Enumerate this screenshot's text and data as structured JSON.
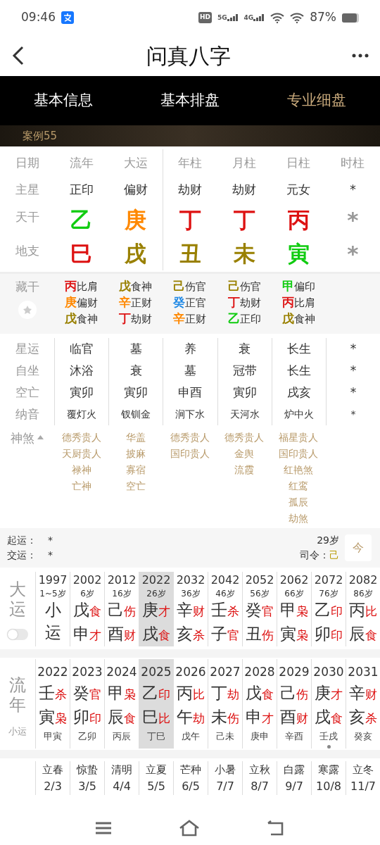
{
  "status_bar": {
    "time": "09:46",
    "hd": "HD",
    "networks": [
      "5G",
      "4G"
    ],
    "battery": "87%"
  },
  "header": {
    "title": "问真八字"
  },
  "tabs": [
    {
      "label": "基本信息",
      "selected": false
    },
    {
      "label": "基本排盘",
      "selected": false
    },
    {
      "label": "专业细盘",
      "selected": true
    }
  ],
  "case_label": "案例55",
  "pillars": {
    "row_labels": [
      "日期",
      "主星",
      "天干",
      "地支"
    ],
    "columns": [
      {
        "heading": "流年",
        "main_star": "正印",
        "stem": {
          "char": "乙",
          "color": "#11cc11"
        },
        "branch": {
          "char": "巳",
          "color": "#dd1111"
        }
      },
      {
        "heading": "大运",
        "main_star": "偏财",
        "stem": {
          "char": "庚",
          "color": "#ff8800"
        },
        "branch": {
          "char": "戌",
          "color": "#998000"
        }
      },
      {
        "heading": "年柱",
        "main_star": "劫财",
        "stem": {
          "char": "丁",
          "color": "#dd1111"
        },
        "branch": {
          "char": "丑",
          "color": "#998000"
        }
      },
      {
        "heading": "月柱",
        "main_star": "劫财",
        "stem": {
          "char": "丁",
          "color": "#dd1111"
        },
        "branch": {
          "char": "未",
          "color": "#998000"
        }
      },
      {
        "heading": "日柱",
        "main_star": "元女",
        "stem": {
          "char": "丙",
          "color": "#dd1111"
        },
        "branch": {
          "char": "寅",
          "color": "#11cc11"
        }
      },
      {
        "heading": "时柱",
        "main_star": "*",
        "stem": {
          "char": "*",
          "color": "#999999"
        },
        "branch": {
          "char": "*",
          "color": "#999999"
        }
      }
    ]
  },
  "hidden_stems": {
    "label": "藏干",
    "columns": [
      [
        {
          "char": "丙",
          "color": "#dd1111",
          "god": "比肩"
        },
        {
          "char": "庚",
          "color": "#ff8800",
          "god": "偏财"
        },
        {
          "char": "戊",
          "color": "#998000",
          "god": "食神"
        }
      ],
      [
        {
          "char": "戊",
          "color": "#998000",
          "god": "食神"
        },
        {
          "char": "辛",
          "color": "#ff8800",
          "god": "正财"
        },
        {
          "char": "丁",
          "color": "#dd1111",
          "god": "劫财"
        }
      ],
      [
        {
          "char": "己",
          "color": "#998000",
          "god": "伤官"
        },
        {
          "char": "癸",
          "color": "#1e88e5",
          "god": "正官"
        },
        {
          "char": "辛",
          "color": "#ff8800",
          "god": "正财"
        }
      ],
      [
        {
          "char": "己",
          "color": "#998000",
          "god": "伤官"
        },
        {
          "char": "丁",
          "color": "#dd1111",
          "god": "劫财"
        },
        {
          "char": "乙",
          "color": "#11cc11",
          "god": "正印"
        }
      ],
      [
        {
          "char": "甲",
          "color": "#11cc11",
          "god": "偏印"
        },
        {
          "char": "丙",
          "color": "#dd1111",
          "god": "比肩"
        },
        {
          "char": "戊",
          "color": "#998000",
          "god": "食神"
        }
      ]
    ]
  },
  "details": [
    {
      "label": "星运",
      "values": [
        "临官",
        "墓",
        "养",
        "衰",
        "长生",
        "*"
      ]
    },
    {
      "label": "自坐",
      "values": [
        "沐浴",
        "衰",
        "墓",
        "冠带",
        "长生",
        "*"
      ]
    },
    {
      "label": "空亡",
      "values": [
        "寅卯",
        "寅卯",
        "申酉",
        "寅卯",
        "戌亥",
        "*"
      ]
    },
    {
      "label": "纳音",
      "values": [
        "覆灯火",
        "钗钏金",
        "涧下水",
        "天河水",
        "炉中火",
        "*"
      ]
    }
  ],
  "shensha": {
    "label": "神煞",
    "expanded": true,
    "columns": [
      [
        "德秀贵人",
        "天厨贵人",
        "禄神",
        "亡神"
      ],
      [
        "华盖",
        "披麻",
        "寡宿",
        "空亡"
      ],
      [
        "德秀贵人",
        "国印贵人"
      ],
      [
        "德秀贵人",
        "金舆",
        "流霞"
      ],
      [
        "福星贵人",
        "国印贵人",
        "红艳煞",
        "红鸾",
        "孤辰",
        "劫煞"
      ]
    ]
  },
  "info": {
    "qiyun_label": "起运：",
    "qiyun_value": "*",
    "jiaoyun_label": "交运：",
    "jiaoyun_value": "*",
    "age": "29岁",
    "siling_label": "司令：",
    "siling_value": "己",
    "calendar_label": "今"
  },
  "dayun": {
    "label": "大运",
    "toggle_on": false,
    "columns": [
      {
        "year": "1997",
        "age": "1~5岁",
        "stem": "小",
        "branch": "运",
        "selected": false
      },
      {
        "year": "2002",
        "age": "6岁",
        "stem": "戊",
        "stem_god": "食",
        "branch": "申",
        "branch_god": "才",
        "selected": false
      },
      {
        "year": "2012",
        "age": "16岁",
        "stem": "己",
        "stem_god": "伤",
        "branch": "酉",
        "branch_god": "财",
        "selected": false
      },
      {
        "year": "2022",
        "age": "26岁",
        "stem": "庚",
        "stem_god": "才",
        "branch": "戌",
        "branch_god": "食",
        "selected": true
      },
      {
        "year": "2032",
        "age": "36岁",
        "stem": "辛",
        "stem_god": "财",
        "branch": "亥",
        "branch_god": "杀",
        "selected": false
      },
      {
        "year": "2042",
        "age": "46岁",
        "stem": "壬",
        "stem_god": "杀",
        "branch": "子",
        "branch_god": "官",
        "selected": false
      },
      {
        "year": "2052",
        "age": "56岁",
        "stem": "癸",
        "stem_god": "官",
        "branch": "丑",
        "branch_god": "伤",
        "selected": false
      },
      {
        "year": "2062",
        "age": "66岁",
        "stem": "甲",
        "stem_god": "枭",
        "branch": "寅",
        "branch_god": "枭",
        "selected": false
      },
      {
        "year": "2072",
        "age": "76岁",
        "stem": "乙",
        "stem_god": "印",
        "branch": "卯",
        "branch_god": "印",
        "selected": false
      },
      {
        "year": "2082",
        "age": "86岁",
        "stem": "丙",
        "stem_god": "比",
        "branch": "辰",
        "branch_god": "食",
        "selected": false
      }
    ]
  },
  "liunian": {
    "label": "流年",
    "sublabel": "小运",
    "columns": [
      {
        "year": "2022",
        "stem": "壬",
        "stem_god": "杀",
        "branch": "寅",
        "branch_god": "枭",
        "xiaoyun": "甲寅",
        "selected": false,
        "marked": false
      },
      {
        "year": "2023",
        "stem": "癸",
        "stem_god": "官",
        "branch": "卯",
        "branch_god": "印",
        "xiaoyun": "乙卯",
        "selected": false,
        "marked": false
      },
      {
        "year": "2024",
        "stem": "甲",
        "stem_god": "枭",
        "branch": "辰",
        "branch_god": "食",
        "xiaoyun": "丙辰",
        "selected": false,
        "marked": false
      },
      {
        "year": "2025",
        "stem": "乙",
        "stem_god": "印",
        "branch": "巳",
        "branch_god": "比",
        "xiaoyun": "丁巳",
        "selected": true,
        "marked": false
      },
      {
        "year": "2026",
        "stem": "丙",
        "stem_god": "比",
        "branch": "午",
        "branch_god": "劫",
        "xiaoyun": "戊午",
        "selected": false,
        "marked": false
      },
      {
        "year": "2027",
        "stem": "丁",
        "stem_god": "劫",
        "branch": "未",
        "branch_god": "伤",
        "xiaoyun": "己未",
        "selected": false,
        "marked": false
      },
      {
        "year": "2028",
        "stem": "戊",
        "stem_god": "食",
        "branch": "申",
        "branch_god": "才",
        "xiaoyun": "庚申",
        "selected": false,
        "marked": false
      },
      {
        "year": "2029",
        "stem": "己",
        "stem_god": "伤",
        "branch": "酉",
        "branch_god": "财",
        "xiaoyun": "辛酉",
        "selected": false,
        "marked": false
      },
      {
        "year": "2030",
        "stem": "庚",
        "stem_god": "才",
        "branch": "戌",
        "branch_god": "食",
        "xiaoyun": "壬戌",
        "selected": false,
        "marked": true
      },
      {
        "year": "2031",
        "stem": "辛",
        "stem_god": "财",
        "branch": "亥",
        "branch_god": "杀",
        "xiaoyun": "癸亥",
        "selected": false,
        "marked": false
      }
    ]
  },
  "jieqi": [
    {
      "name": "立春",
      "date": "2/3"
    },
    {
      "name": "惊蛰",
      "date": "3/5"
    },
    {
      "name": "清明",
      "date": "4/4"
    },
    {
      "name": "立夏",
      "date": "5/5"
    },
    {
      "name": "芒种",
      "date": "6/5"
    },
    {
      "name": "小暑",
      "date": "7/7"
    },
    {
      "name": "立秋",
      "date": "8/7"
    },
    {
      "name": "白露",
      "date": "9/7"
    },
    {
      "name": "寒露",
      "date": "10/8"
    },
    {
      "name": "立冬",
      "date": "11/7"
    }
  ]
}
